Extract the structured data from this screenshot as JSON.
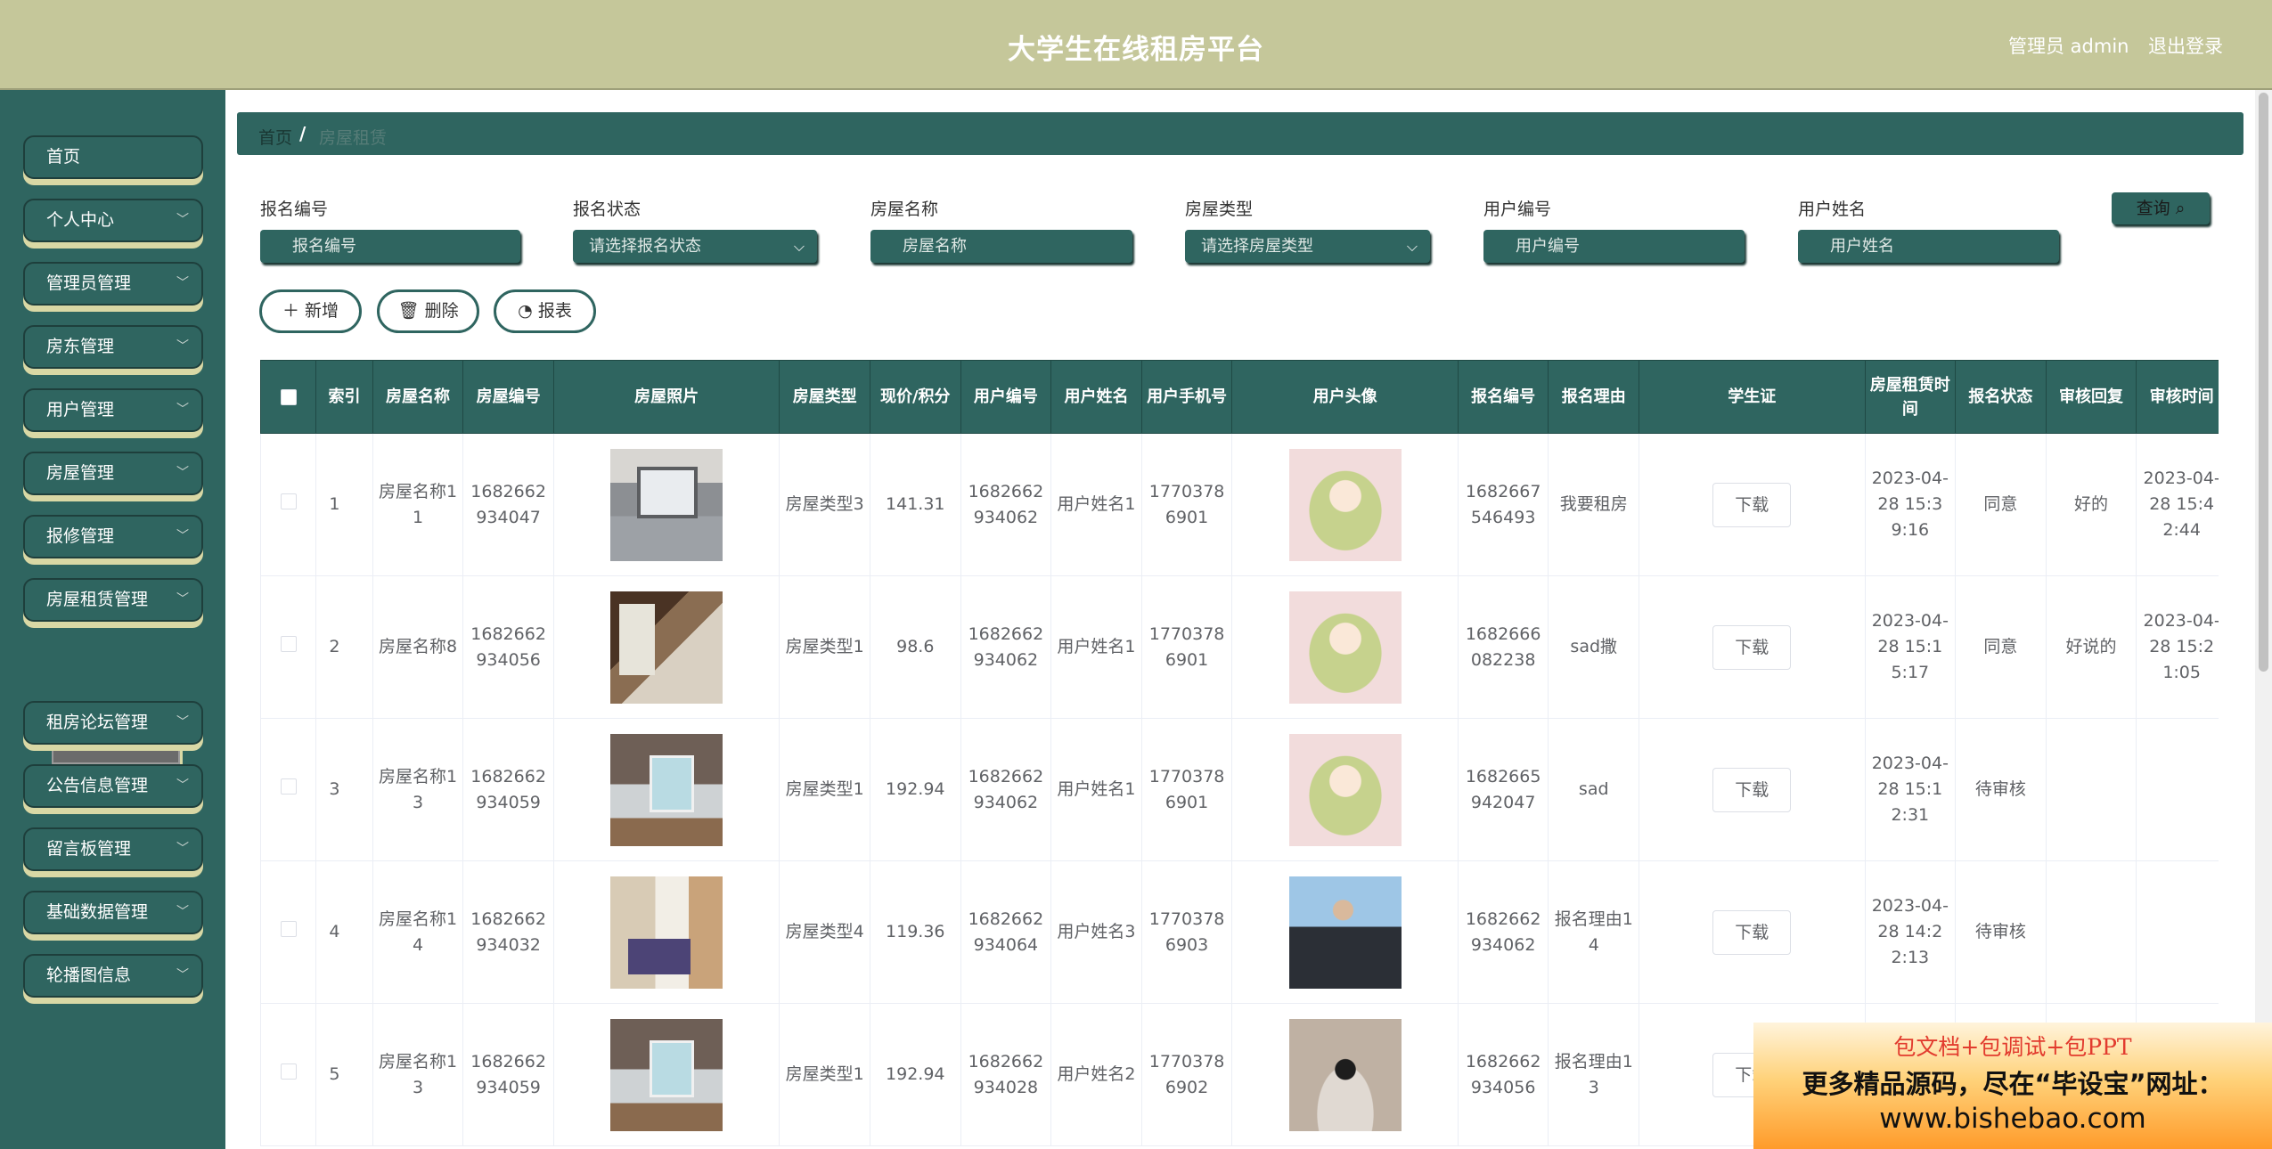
{
  "header": {
    "title": "大学生在线租房平台",
    "admin_label": "管理员 admin",
    "logout": "退出登录"
  },
  "sidebar": {
    "items": [
      {
        "label": "首页",
        "has_arrow": false
      },
      {
        "label": "个人中心",
        "has_arrow": true
      },
      {
        "label": "管理员管理",
        "has_arrow": true
      },
      {
        "label": "房东管理",
        "has_arrow": true
      },
      {
        "label": "用户管理",
        "has_arrow": true
      },
      {
        "label": "房屋管理",
        "has_arrow": true
      },
      {
        "label": "报修管理",
        "has_arrow": true
      },
      {
        "label": "房屋租赁管理",
        "has_arrow": true
      },
      {
        "label": "租房论坛管理",
        "has_arrow": true
      },
      {
        "label": "公告信息管理",
        "has_arrow": true
      },
      {
        "label": "留言板管理",
        "has_arrow": true
      },
      {
        "label": "基础数据管理",
        "has_arrow": true
      },
      {
        "label": "轮播图信息",
        "has_arrow": true
      }
    ],
    "submenu_active": "房屋租赁管理"
  },
  "breadcrumb": {
    "home": "首页",
    "separator": "/",
    "current": "房屋租赁"
  },
  "filters": {
    "baoming_bianhao": {
      "label": "报名编号",
      "placeholder": "报名编号"
    },
    "baoming_zhuangtai": {
      "label": "报名状态",
      "placeholder": "请选择报名状态"
    },
    "fangwu_mingcheng": {
      "label": "房屋名称",
      "placeholder": "房屋名称"
    },
    "fangwu_leixing": {
      "label": "房屋类型",
      "placeholder": "请选择房屋类型"
    },
    "yonghu_bianhao": {
      "label": "用户编号",
      "placeholder": "用户编号"
    },
    "yonghu_xingming": {
      "label": "用户姓名",
      "placeholder": "用户姓名"
    },
    "query_label": "查询",
    "chevron_icon": "chevron-down-icon",
    "search_icon": "search-icon"
  },
  "actions": {
    "add": "新增",
    "delete": "删除",
    "report": "报表",
    "add_icon": "plus-icon",
    "delete_icon": "trash-icon",
    "report_icon": "pie-chart-icon"
  },
  "table": {
    "columns": [
      "索引",
      "房屋名称",
      "房屋编号",
      "房屋照片",
      "房屋类型",
      "现价/积分",
      "用户编号",
      "用户姓名",
      "用户手机号",
      "用户头像",
      "报名编号",
      "报名理由",
      "学生证",
      "房屋租赁时间",
      "报名状态",
      "审核回复",
      "审核时间"
    ],
    "download_label": "下载",
    "rows": [
      {
        "index": "1",
        "name": "房屋名称11",
        "house_no": "1682662934047",
        "photo": "room-photo-icon",
        "type": "房屋类型3",
        "price": "141.31",
        "user_no": "1682662934062",
        "user_name": "用户姓名1",
        "phone": "17703786901",
        "avatar": "anime-avatar-icon",
        "apply_no": "1682667546493",
        "reason": "我要租房",
        "rent_time": "2023-04-28 15:39:16",
        "status": "同意",
        "reply": "好的",
        "audit_time": "2023-04-28 15:42:44"
      },
      {
        "index": "2",
        "name": "房屋名称8",
        "house_no": "1682662934056",
        "photo": "room-photo-icon",
        "type": "房屋类型1",
        "price": "98.6",
        "user_no": "1682662934062",
        "user_name": "用户姓名1",
        "phone": "17703786901",
        "avatar": "anime-avatar-icon",
        "apply_no": "1682666082238",
        "reason": "sad撒",
        "rent_time": "2023-04-28 15:15:17",
        "status": "同意",
        "reply": "好说的",
        "audit_time": "2023-04-28 15:21:05"
      },
      {
        "index": "3",
        "name": "房屋名称13",
        "house_no": "1682662934059",
        "photo": "room-photo-icon",
        "type": "房屋类型1",
        "price": "192.94",
        "user_no": "1682662934062",
        "user_name": "用户姓名1",
        "phone": "17703786901",
        "avatar": "anime-avatar-icon",
        "apply_no": "1682665942047",
        "reason": "sad",
        "rent_time": "2023-04-28 15:12:31",
        "status": "待审核",
        "reply": "",
        "audit_time": ""
      },
      {
        "index": "4",
        "name": "房屋名称14",
        "house_no": "1682662934032",
        "photo": "room-photo-icon",
        "type": "房屋类型4",
        "price": "119.36",
        "user_no": "1682662934064",
        "user_name": "用户姓名3",
        "phone": "17703786903",
        "avatar": "user-photo-icon",
        "apply_no": "1682662934062",
        "reason": "报名理由14",
        "rent_time": "2023-04-28 14:22:13",
        "status": "待审核",
        "reply": "",
        "audit_time": ""
      },
      {
        "index": "5",
        "name": "房屋名称13",
        "house_no": "1682662934059",
        "photo": "room-photo-icon",
        "type": "房屋类型1",
        "price": "192.94",
        "user_no": "1682662934028",
        "user_name": "用户姓名2",
        "phone": "17703786902",
        "avatar": "user-photo-icon",
        "apply_no": "1682662934056",
        "reason": "报名理由13",
        "rent_time": "",
        "status": "",
        "reply": "",
        "audit_time": ""
      }
    ]
  },
  "promo": {
    "line1": "包文档+包调试+包PPT",
    "line2": "更多精品源码，尽在“毕设宝”网址：",
    "line3": "www.bishebao.com"
  }
}
